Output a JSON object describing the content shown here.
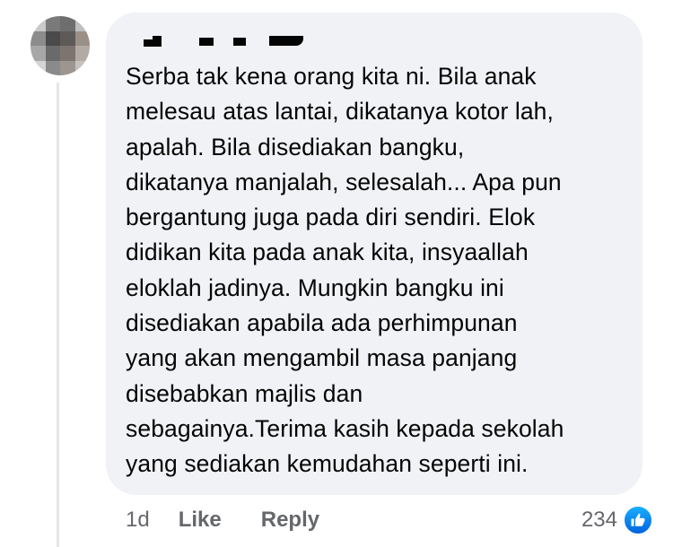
{
  "comment": {
    "author_redacted": true,
    "text": "Serba tak kena orang kita ni. Bila anak\nmelesau atas lantai, dikatanya kotor lah,\napalah. Bila disediakan bangku,\ndikatanya manjalah, selesalah... Apa pun\nbergantung juga pada diri sendiri. Elok\ndidikan kita pada anak kita, insyaallah\neloklah jadinya. Mungkin bangku ini\ndisediakan apabila ada perhimpunan\nyang akan mengambil masa panjang\ndisebabkan majlis dan\nsebagainya.Terima kasih kepada sekolah\nyang sediakan kemudahan seperti ini."
  },
  "actions": {
    "time": "1d",
    "like_label": "Like",
    "reply_label": "Reply"
  },
  "reactions": {
    "count": "234",
    "icon": "thumbs-up-icon",
    "icon_color": "#1877f2"
  },
  "colors": {
    "bubble_bg": "#f0f2f5",
    "text": "#050505",
    "secondary_text": "#65676b"
  }
}
